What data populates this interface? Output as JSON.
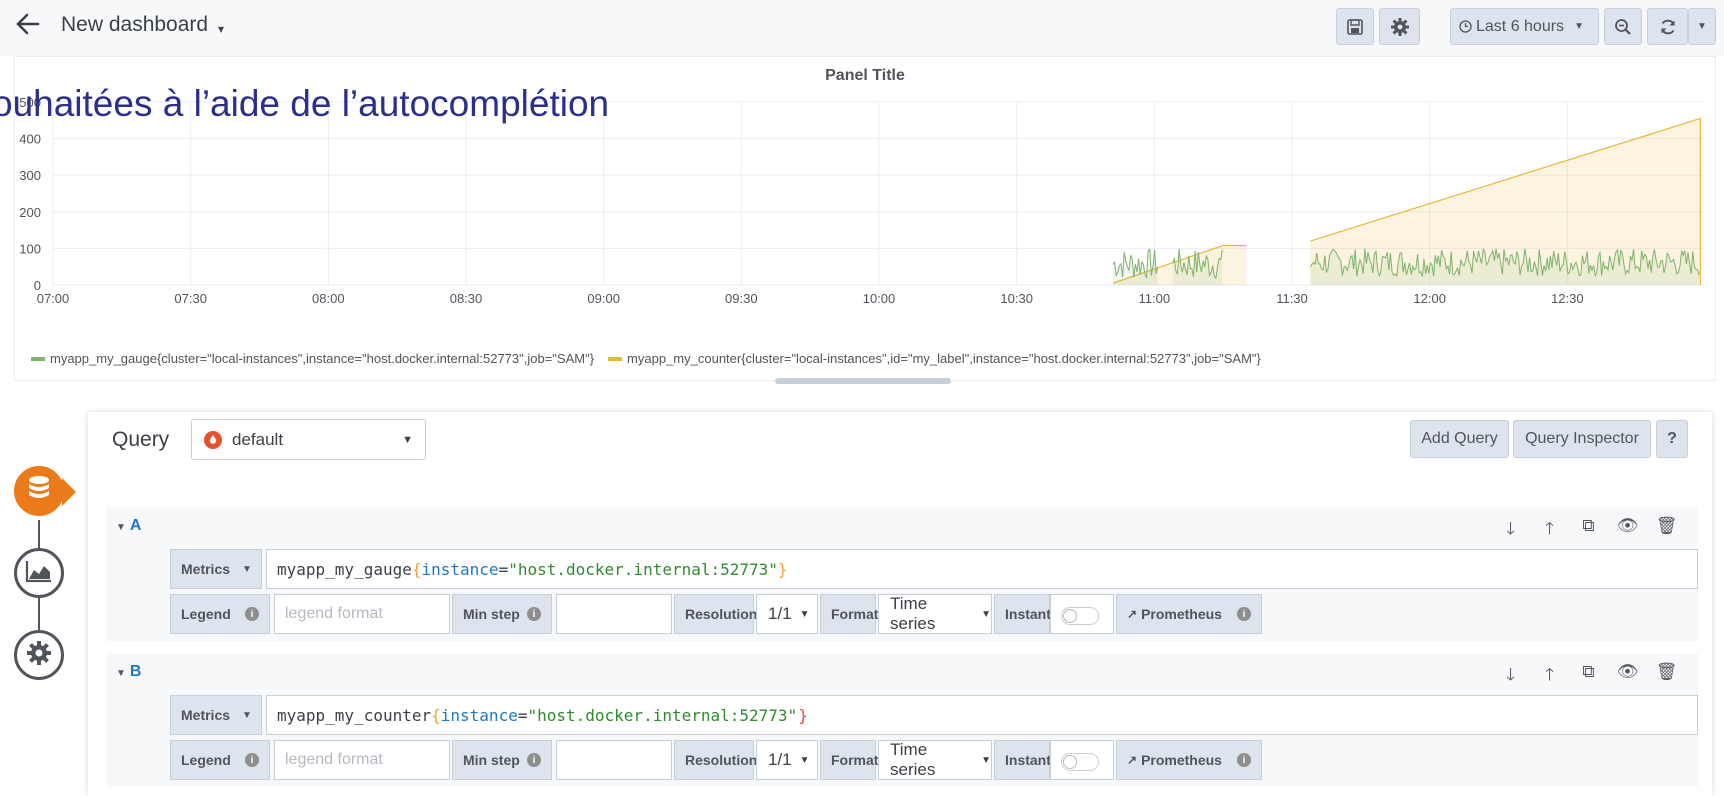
{
  "header": {
    "back_icon": "arrow-left-icon",
    "title": "New dashboard",
    "title_caret": "▾",
    "time_range_label": "Last 6 hours"
  },
  "panel": {
    "title": "Panel Title",
    "overlay_text": "ouhaitées à l’aide de l’autocomplétion"
  },
  "chart_data": {
    "type": "line",
    "title": "Panel Title",
    "x_ticks": [
      "07:00",
      "07:30",
      "08:00",
      "08:30",
      "09:00",
      "09:30",
      "10:00",
      "10:30",
      "11:00",
      "11:30",
      "12:00",
      "12:30"
    ],
    "y_ticks": [
      "0",
      "100",
      "200",
      "300",
      "400",
      "500"
    ],
    "ylim": [
      0,
      500
    ],
    "grid": true,
    "legend_position": "bottom",
    "series": [
      {
        "name": "myapp_my_gauge{cluster=\"local-instances\",instance=\"host.docker.internal:52773\",job=\"SAM\"}",
        "color": "#7eb26d",
        "segments": [
          {
            "start": "10:51",
            "end": "11:01",
            "min": 0,
            "max": 100
          },
          {
            "start": "11:04",
            "end": "11:15",
            "min": 0,
            "max": 100
          },
          {
            "start": "11:34",
            "end": "12:59",
            "min": 10,
            "max": 100
          }
        ]
      },
      {
        "name": "myapp_my_counter{cluster=\"local-instances\",id=\"my_label\",instance=\"host.docker.internal:52773\",job=\"SAM\"}",
        "color": "#eab839",
        "segments": [
          {
            "points": [
              [
                "10:51",
                5
              ],
              [
                "11:15",
                108
              ],
              [
                "11:20",
                108
              ]
            ]
          },
          {
            "points": [
              [
                "11:34",
                120
              ],
              [
                "12:59",
                455
              ],
              [
                "12:59",
                0
              ]
            ]
          }
        ]
      }
    ]
  },
  "editor": {
    "query_label": "Query",
    "datasource": "default",
    "add_query": "Add Query",
    "query_inspector": "Query Inspector",
    "help": "?",
    "queries": [
      {
        "ref_id": "A",
        "metrics_label": "Metrics",
        "expr_name": "myapp_my_gauge",
        "expr_key": "instance",
        "expr_value": "\"host.docker.internal:52773\"",
        "legend_label": "Legend",
        "legend_placeholder": "legend format",
        "min_step_label": "Min step",
        "resolution_label": "Resolution",
        "resolution_value": "1/1",
        "format_label": "Format",
        "format_value": "Time series",
        "instant_label": "Instant",
        "prometheus_label": "Prometheus"
      },
      {
        "ref_id": "B",
        "metrics_label": "Metrics",
        "expr_name": "myapp_my_counter",
        "expr_key": "instance",
        "expr_value": "\"host.docker.internal:52773\"",
        "legend_label": "Legend",
        "legend_placeholder": "legend format",
        "min_step_label": "Min step",
        "resolution_label": "Resolution",
        "resolution_value": "1/1",
        "format_label": "Format",
        "format_value": "Time series",
        "instant_label": "Instant",
        "prometheus_label": "Prometheus"
      }
    ]
  },
  "colors": {
    "accent_orange": "#eb7b18",
    "link_blue": "#1f78c1",
    "gauge_green": "#7eb26d",
    "counter_yellow": "#eab839"
  }
}
